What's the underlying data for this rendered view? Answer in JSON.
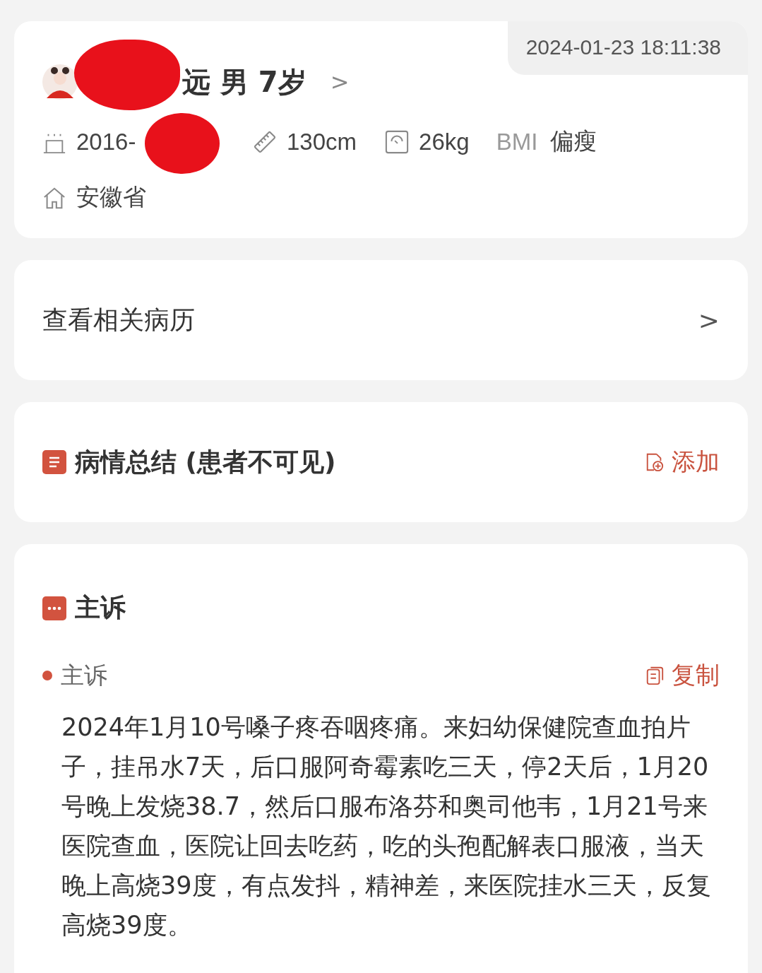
{
  "patient": {
    "timestamp": "2024-01-23 18:11:38",
    "name": "远 男 7岁",
    "chevron": ">",
    "birthdate": "2016-",
    "height": "130cm",
    "weight": "26kg",
    "bmi_label": "BMI",
    "bmi_value": "偏瘦",
    "province": "安徽省"
  },
  "records_link": {
    "label": "查看相关病历",
    "chevron": ">"
  },
  "summary": {
    "title": "病情总结 (患者不可见)",
    "action": "添加"
  },
  "complaint": {
    "title": "主诉",
    "field_label": "主诉",
    "action": "复制",
    "text": "2024年1月10号嗓子疼吞咽疼痛。来妇幼保健院查血拍片子，挂吊水7天，后口服阿奇霉素吃三天，停2天后，1月20号晚上发烧38.7，然后口服布洛芬和奥司他韦，1月21号来医院查血，医院让回去吃药，吃的头孢配解表口服液，当天晚上高烧39度，有点发抖，精神差，来医院挂水三天，反复高烧39度。"
  }
}
